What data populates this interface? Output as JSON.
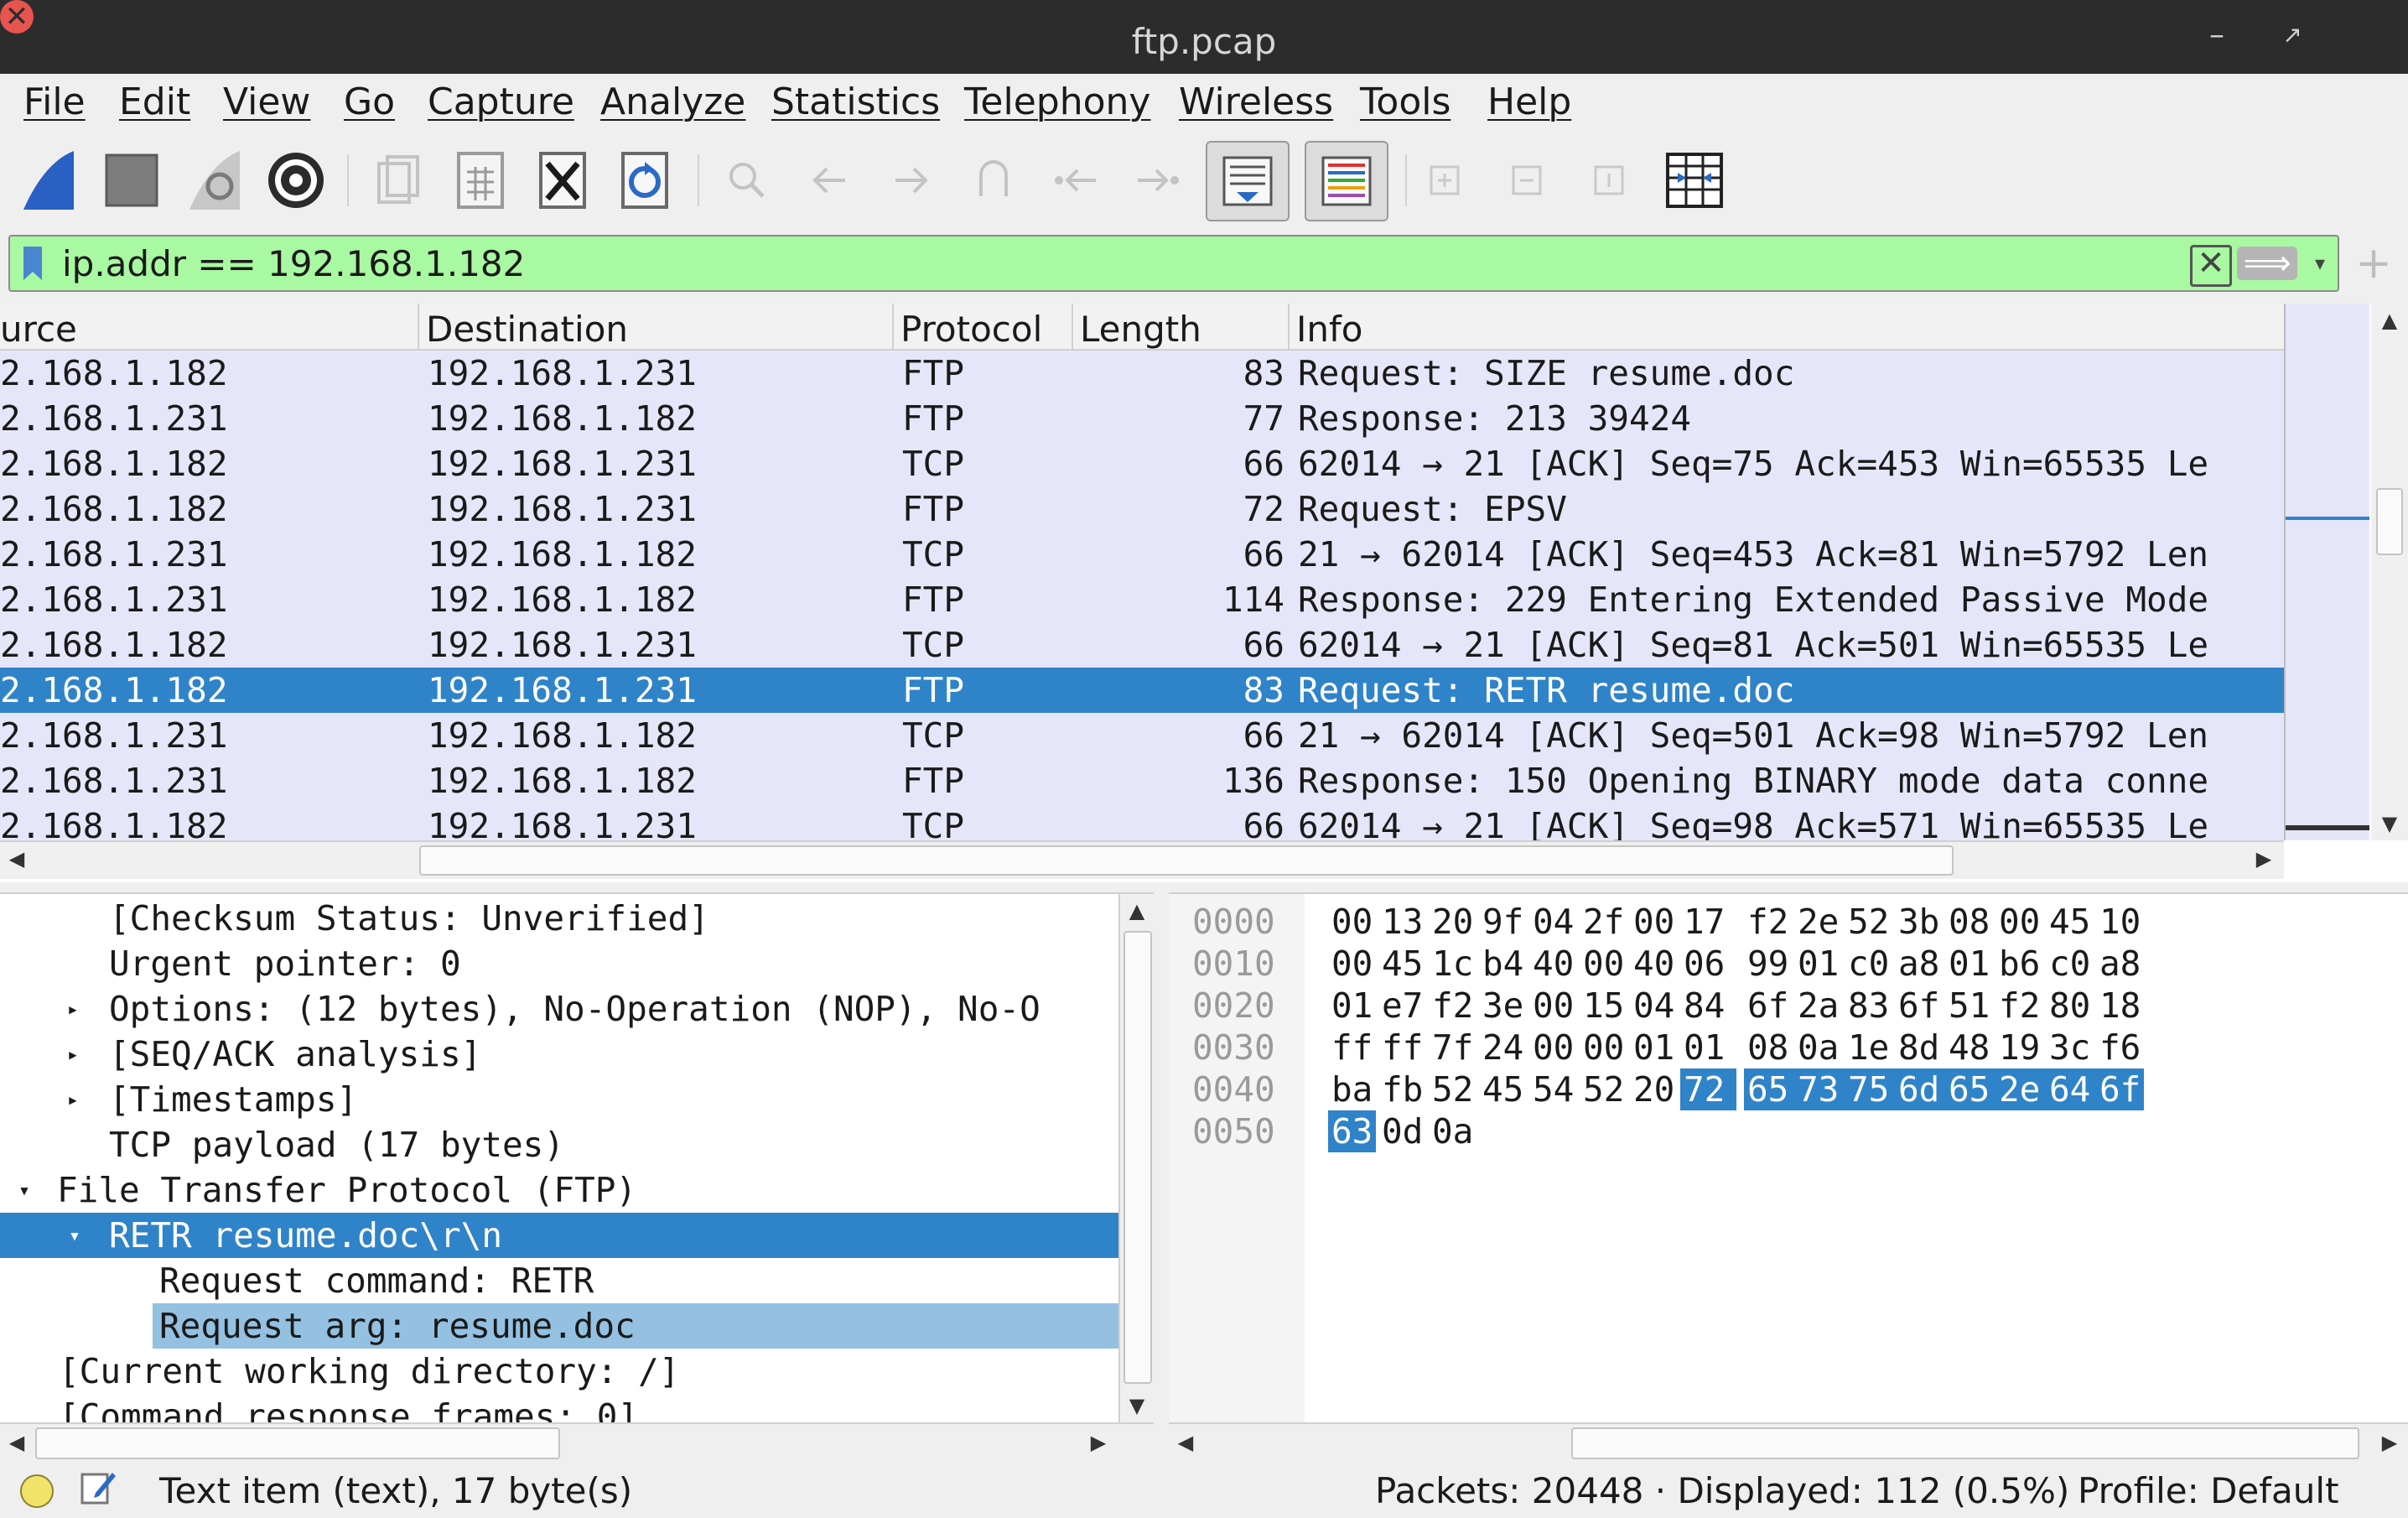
{
  "window": {
    "title": "ftp.pcap",
    "minimize": "–",
    "restore": "↗",
    "close": "✕"
  },
  "menu": [
    "File",
    "Edit",
    "View",
    "Go",
    "Capture",
    "Analyze",
    "Statistics",
    "Telephony",
    "Wireless",
    "Tools",
    "Help"
  ],
  "filter": {
    "value": "ip.addr == 192.168.1.182",
    "clear_icon": "✕",
    "apply_icon": "⟹",
    "dropdown_icon": "▾",
    "add_icon": "+",
    "bg_color": "#a9f8a2"
  },
  "packet_list": {
    "columns": [
      "urce",
      "Destination",
      "Protocol",
      "Length",
      "Info"
    ],
    "rows": [
      {
        "src": "2.168.1.182",
        "dst": "192.168.1.231",
        "proto": "FTP",
        "len": "83",
        "info": "Request: SIZE resume.doc"
      },
      {
        "src": "2.168.1.231",
        "dst": "192.168.1.182",
        "proto": "FTP",
        "len": "77",
        "info": "Response: 213 39424"
      },
      {
        "src": "2.168.1.182",
        "dst": "192.168.1.231",
        "proto": "TCP",
        "len": "66",
        "info": "62014 → 21 [ACK] Seq=75 Ack=453 Win=65535 Le"
      },
      {
        "src": "2.168.1.182",
        "dst": "192.168.1.231",
        "proto": "FTP",
        "len": "72",
        "info": "Request: EPSV"
      },
      {
        "src": "2.168.1.231",
        "dst": "192.168.1.182",
        "proto": "TCP",
        "len": "66",
        "info": "21 → 62014 [ACK] Seq=453 Ack=81 Win=5792 Len"
      },
      {
        "src": "2.168.1.231",
        "dst": "192.168.1.182",
        "proto": "FTP",
        "len": "114",
        "info": "Response: 229 Entering Extended Passive Mode"
      },
      {
        "src": "2.168.1.182",
        "dst": "192.168.1.231",
        "proto": "TCP",
        "len": "66",
        "info": "62014 → 21 [ACK] Seq=81 Ack=501 Win=65535 Le"
      },
      {
        "src": "2.168.1.182",
        "dst": "192.168.1.231",
        "proto": "FTP",
        "len": "83",
        "info": "Request: RETR resume.doc"
      },
      {
        "src": "2.168.1.231",
        "dst": "192.168.1.182",
        "proto": "TCP",
        "len": "66",
        "info": "21 → 62014 [ACK] Seq=501 Ack=98 Win=5792 Len"
      },
      {
        "src": "2.168.1.231",
        "dst": "192.168.1.182",
        "proto": "FTP",
        "len": "136",
        "info": "Response: 150 Opening BINARY mode data conne"
      },
      {
        "src": "2.168.1.182",
        "dst": "192.168.1.231",
        "proto": "TCP",
        "len": "66",
        "info": "62014 → 21 [ACK] Seq=98 Ack=571 Win=65535 Le"
      }
    ],
    "row_color": "#e6e6fa",
    "selected_color": "#2f83c9"
  },
  "details": [
    {
      "text": "[Checksum Status: Unverified]",
      "arrow": ""
    },
    {
      "text": "Urgent pointer: 0",
      "arrow": ""
    },
    {
      "text": "Options: (12 bytes), No-Operation (NOP), No-O",
      "arrow": "▸"
    },
    {
      "text": "[SEQ/ACK analysis]",
      "arrow": "▸"
    },
    {
      "text": "[Timestamps]",
      "arrow": "▸"
    },
    {
      "text": "TCP payload (17 bytes)",
      "arrow": ""
    },
    {
      "text": "File Transfer Protocol (FTP)",
      "arrow": "▾"
    },
    {
      "text": "RETR resume.doc\\r\\n",
      "arrow": "▾"
    },
    {
      "text": "Request command: RETR",
      "arrow": ""
    },
    {
      "text": "Request arg: resume.doc",
      "arrow": ""
    },
    {
      "text": "[Current working directory: /]",
      "arrow": ""
    },
    {
      "text": "[Command response frames: 0]",
      "arrow": ""
    }
  ],
  "bytes": [
    {
      "offset": "0000",
      "hex": [
        "00",
        "13",
        "20",
        "9f",
        "04",
        "2f",
        "00",
        "17",
        "f2",
        "2e",
        "52",
        "3b",
        "08",
        "00",
        "45",
        "10"
      ]
    },
    {
      "offset": "0010",
      "hex": [
        "00",
        "45",
        "1c",
        "b4",
        "40",
        "00",
        "40",
        "06",
        "99",
        "01",
        "c0",
        "a8",
        "01",
        "b6",
        "c0",
        "a8"
      ]
    },
    {
      "offset": "0020",
      "hex": [
        "01",
        "e7",
        "f2",
        "3e",
        "00",
        "15",
        "04",
        "84",
        "6f",
        "2a",
        "83",
        "6f",
        "51",
        "f2",
        "80",
        "18"
      ]
    },
    {
      "offset": "0030",
      "hex": [
        "ff",
        "ff",
        "7f",
        "24",
        "00",
        "00",
        "01",
        "01",
        "08",
        "0a",
        "1e",
        "8d",
        "48",
        "19",
        "3c",
        "f6"
      ]
    },
    {
      "offset": "0040",
      "hex": [
        "ba",
        "fb",
        "52",
        "45",
        "54",
        "52",
        "20",
        "72",
        "65",
        "73",
        "75",
        "6d",
        "65",
        "2e",
        "64",
        "6f"
      ]
    },
    {
      "offset": "0050",
      "hex": [
        "63",
        "0d",
        "0a"
      ]
    }
  ],
  "status": {
    "item_text": "Text item (text), 17 byte(s)",
    "packets": "Packets: 20448 · Displayed: 112 (0.5%)",
    "profile": "Profile: Default",
    "dot_color": "#f1e36a"
  },
  "icons": {
    "start": "shark-fin-icon",
    "stop": "stop-square-icon",
    "restart": "restart-fin-icon",
    "options": "gear-icon",
    "open": "open-file-icon",
    "save": "save-file-icon",
    "close_file": "close-file-icon",
    "reload": "reload-file-icon",
    "find": "search-icon",
    "back": "arrow-left-icon",
    "forward": "arrow-right-icon",
    "goto": "go-to-icon",
    "first": "first-packet-icon",
    "last": "last-packet-icon",
    "autoscroll": "autoscroll-icon",
    "colorize": "colorize-icon",
    "zoom_in": "zoom-in-icon",
    "zoom_out": "zoom-out-icon",
    "zoom_normal": "zoom-normal-icon",
    "resize": "resize-columns-icon"
  }
}
